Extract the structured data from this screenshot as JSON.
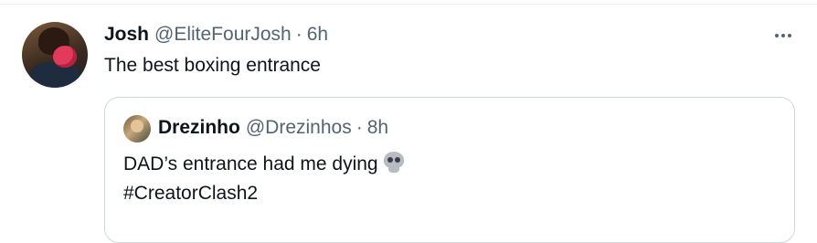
{
  "tweet": {
    "author_name": "Josh",
    "author_handle": "@EliteFourJosh",
    "separator": "·",
    "time": "6h",
    "text": "The best boxing entrance",
    "more_icon": "more-horizontal-icon"
  },
  "quoted_tweet": {
    "author_name": "Drezinho",
    "author_handle": "@Drezinhos",
    "separator": "·",
    "time": "8h",
    "text_line1": "DAD’s entrance had me dying",
    "emoji": "skull-emoji",
    "text_line2": "#CreatorClash2"
  },
  "colors": {
    "text_primary": "#0f1419",
    "text_secondary": "#536471",
    "border": "#cfd9de"
  }
}
